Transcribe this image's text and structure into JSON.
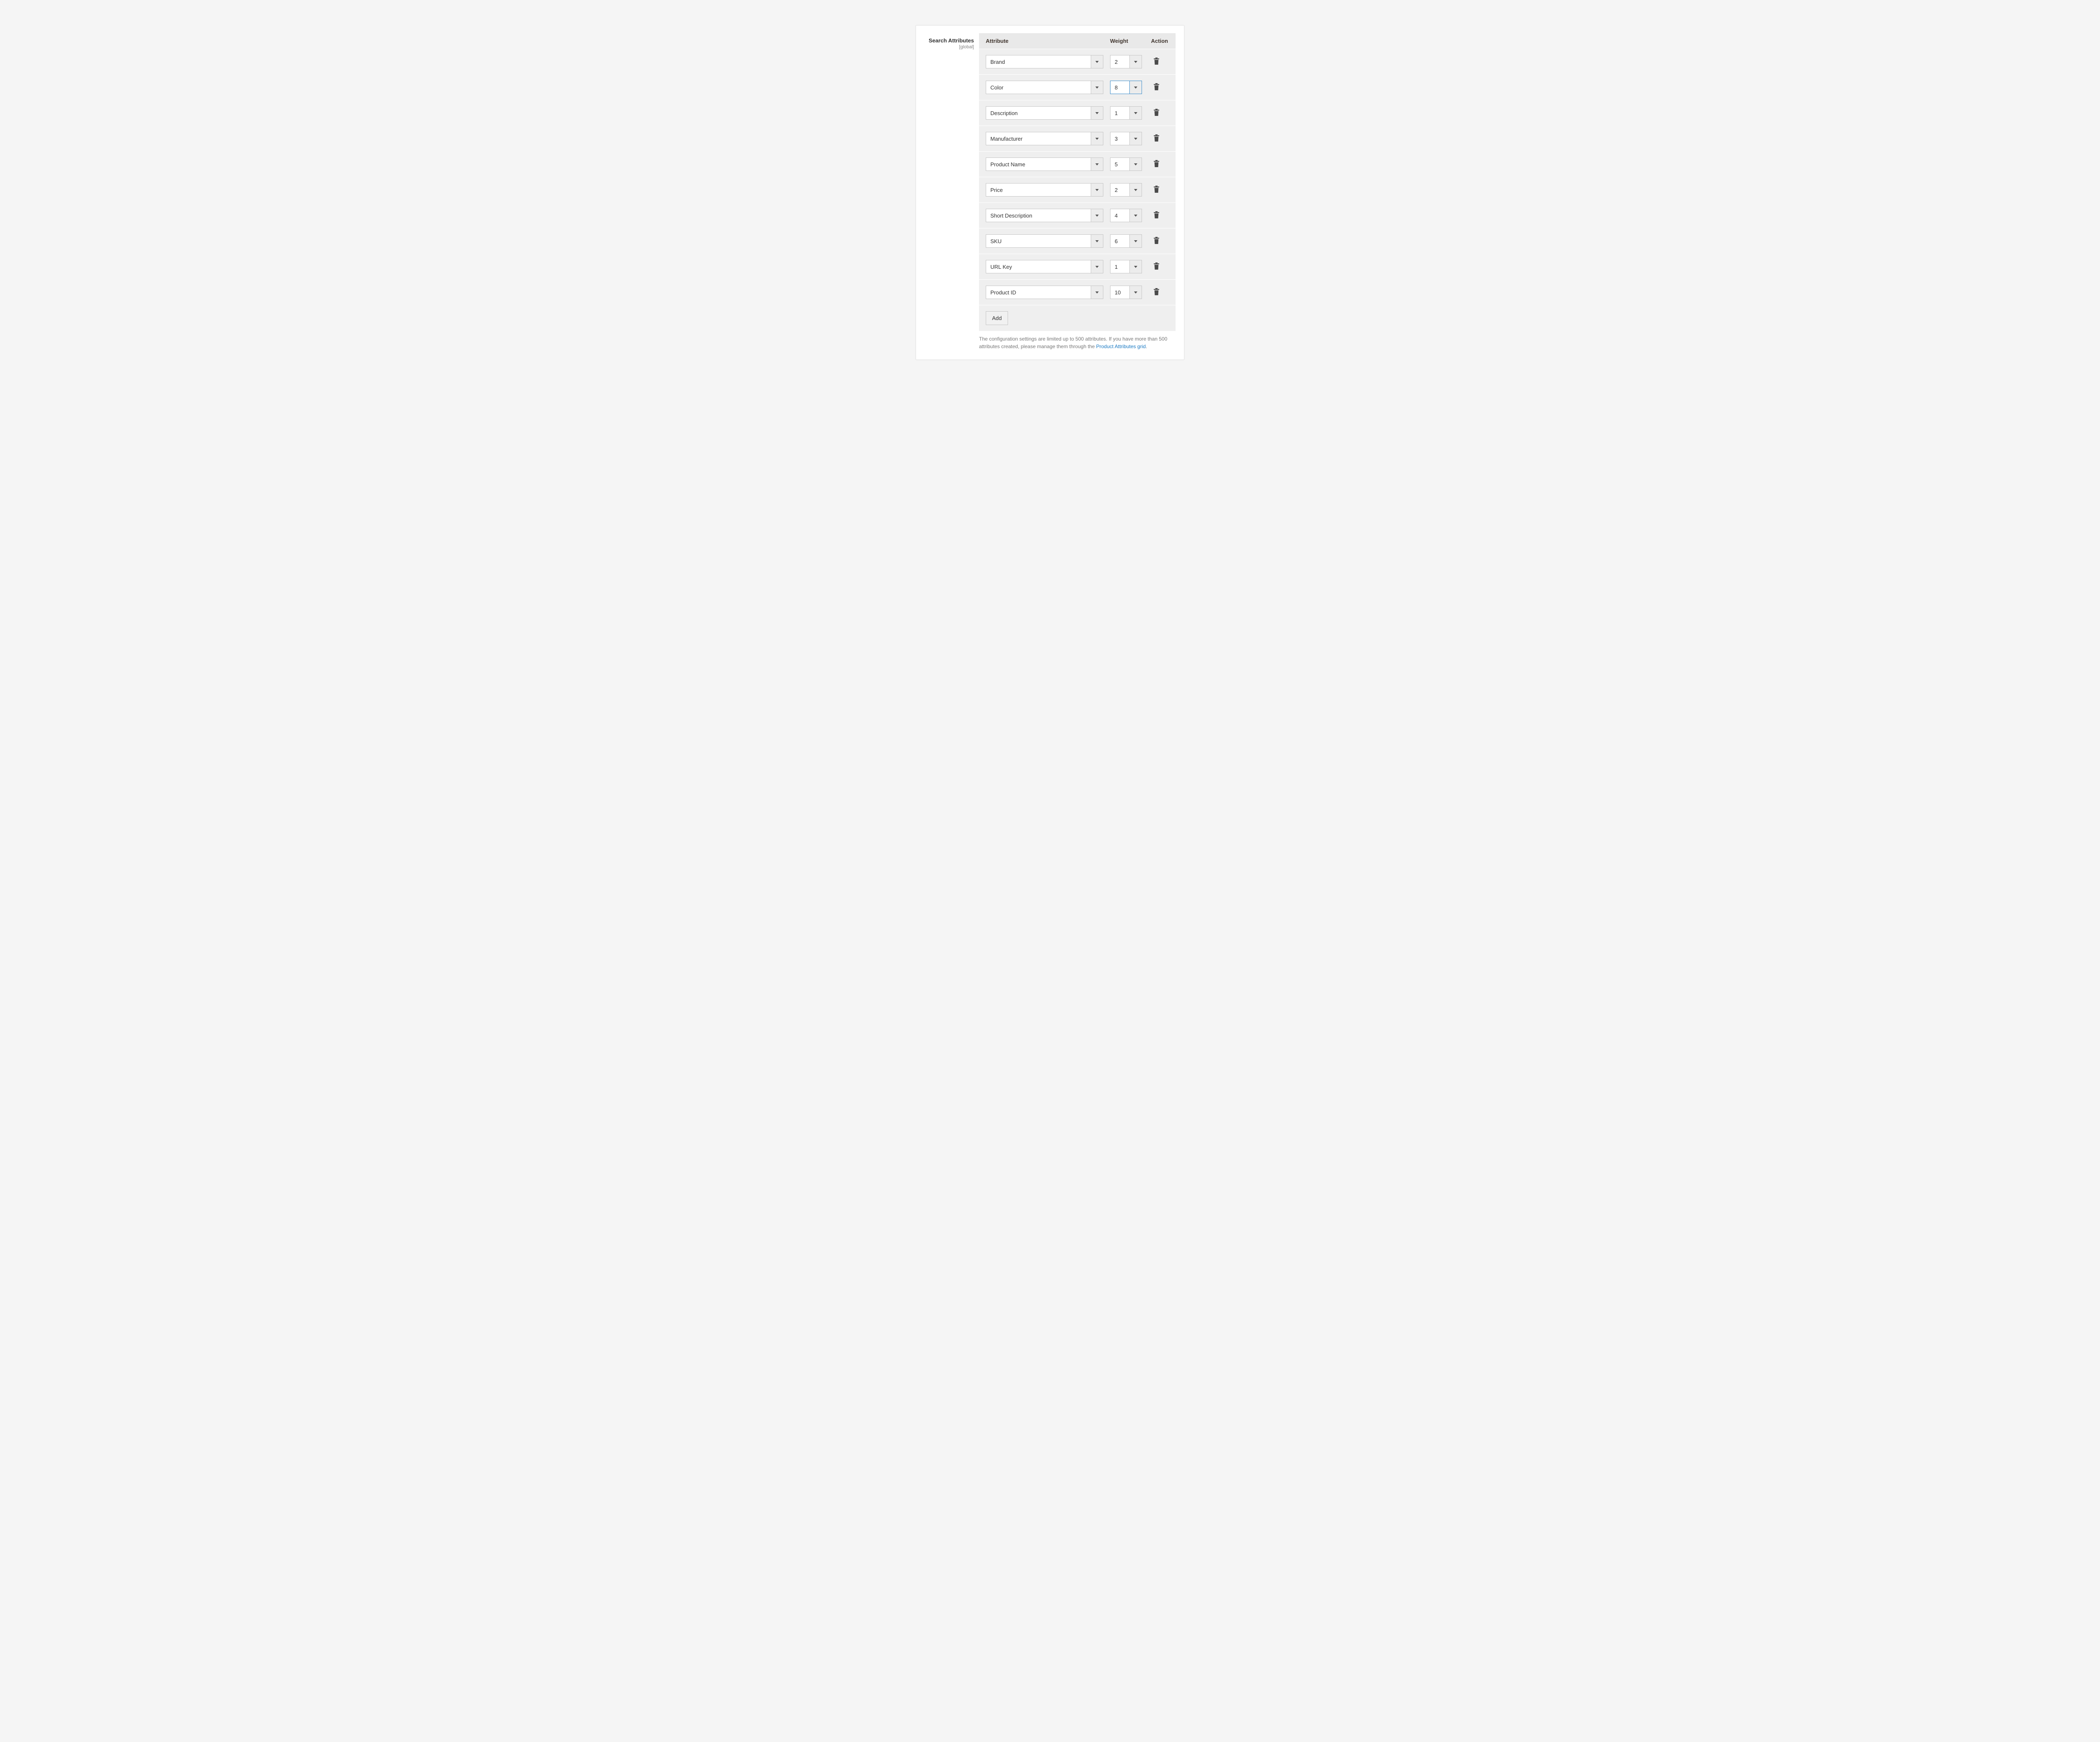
{
  "section": {
    "title": "Search Attributes",
    "scope": "[global]"
  },
  "table": {
    "headers": {
      "attribute": "Attribute",
      "weight": "Weight",
      "action": "Action"
    },
    "rows": [
      {
        "attribute": "Brand",
        "weight": "2",
        "active": false
      },
      {
        "attribute": "Color",
        "weight": "8",
        "active": true
      },
      {
        "attribute": "Description",
        "weight": "1",
        "active": false
      },
      {
        "attribute": "Manufacturer",
        "weight": "3",
        "active": false
      },
      {
        "attribute": "Product Name",
        "weight": "5",
        "active": false
      },
      {
        "attribute": "Price",
        "weight": "2",
        "active": false
      },
      {
        "attribute": "Short Description",
        "weight": "4",
        "active": false
      },
      {
        "attribute": "SKU",
        "weight": "6",
        "active": false
      },
      {
        "attribute": "URL Key",
        "weight": "1",
        "active": false
      },
      {
        "attribute": "Product ID",
        "weight": "10",
        "active": false
      }
    ],
    "add_label": "Add"
  },
  "note": {
    "text": "The configuration settings are limited up to 500 attributes. If you have more than 500 attributes created, please manage them through the ",
    "link_text": "Product Attributes grid",
    "suffix": "."
  }
}
